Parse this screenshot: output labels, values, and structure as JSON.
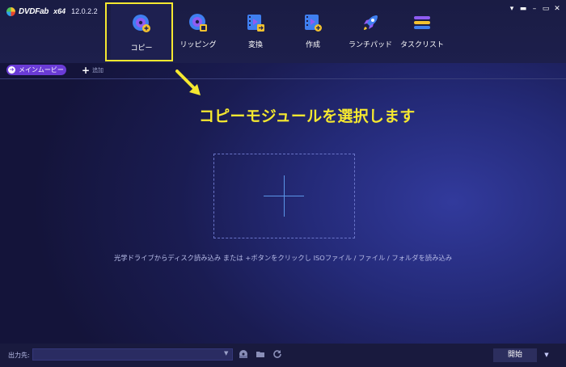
{
  "app": {
    "name": "DVDFab",
    "arch": "x64",
    "version": "12.0.2.2"
  },
  "window_controls": [
    "▾",
    "▬",
    "–",
    "▭",
    "✕"
  ],
  "modules": [
    {
      "id": "copy",
      "label": "コピー",
      "icon": "disc-copy-icon",
      "selected": true
    },
    {
      "id": "ripping",
      "label": "リッピング",
      "icon": "disc-rip-icon"
    },
    {
      "id": "convert",
      "label": "変換",
      "icon": "film-convert-icon"
    },
    {
      "id": "create",
      "label": "作成",
      "icon": "film-create-icon"
    },
    {
      "id": "launchpad",
      "label": "ランチパッド",
      "icon": "rocket-icon"
    },
    {
      "id": "tasklist",
      "label": "タスクリスト",
      "icon": "task-list-icon"
    }
  ],
  "toolbar": {
    "home_label": "メインムービー",
    "add_label": "追加"
  },
  "annotation": "コピーモジュールを選択します",
  "dropzone": {
    "hint": "光学ドライブからディスク読み込み または +ボタンをクリックし ISOファイル / ファイル / フォルダを読み込み"
  },
  "bottom": {
    "output_label": "出力先:",
    "output_value": "",
    "start_label": "開始"
  },
  "colors": {
    "accent_purple": "#6a3bd6",
    "highlight_yellow": "#f5e830",
    "plus_blue": "#5b95e8"
  }
}
